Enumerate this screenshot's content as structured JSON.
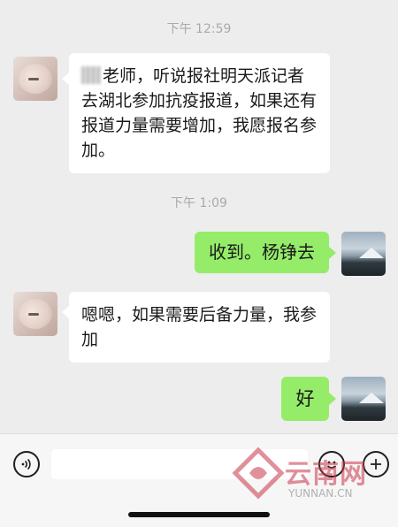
{
  "chat": {
    "timestamps": [
      "下午 12:59",
      "下午 1:09"
    ],
    "messages": [
      {
        "side": "left",
        "text_after_redaction": "老师，听说报社明天派记者去湖北参加抗疫报道，如果还有报道力量需要增加，我愿报名参加。"
      },
      {
        "side": "right",
        "text": "收到。杨铮去"
      },
      {
        "side": "left",
        "text": "嗯嗯，如果需要后备力量，我参加"
      },
      {
        "side": "right",
        "text": "好"
      }
    ]
  },
  "watermark": {
    "brand": "云南网",
    "url": "YUNNAN.CN"
  },
  "icons": {
    "voice": "voice-icon",
    "emoji": "emoji-icon",
    "plus": "plus-icon"
  },
  "colors": {
    "background": "#ededed",
    "sent_bubble": "#95ec69",
    "received_bubble": "#ffffff",
    "watermark": "#c9374a"
  }
}
